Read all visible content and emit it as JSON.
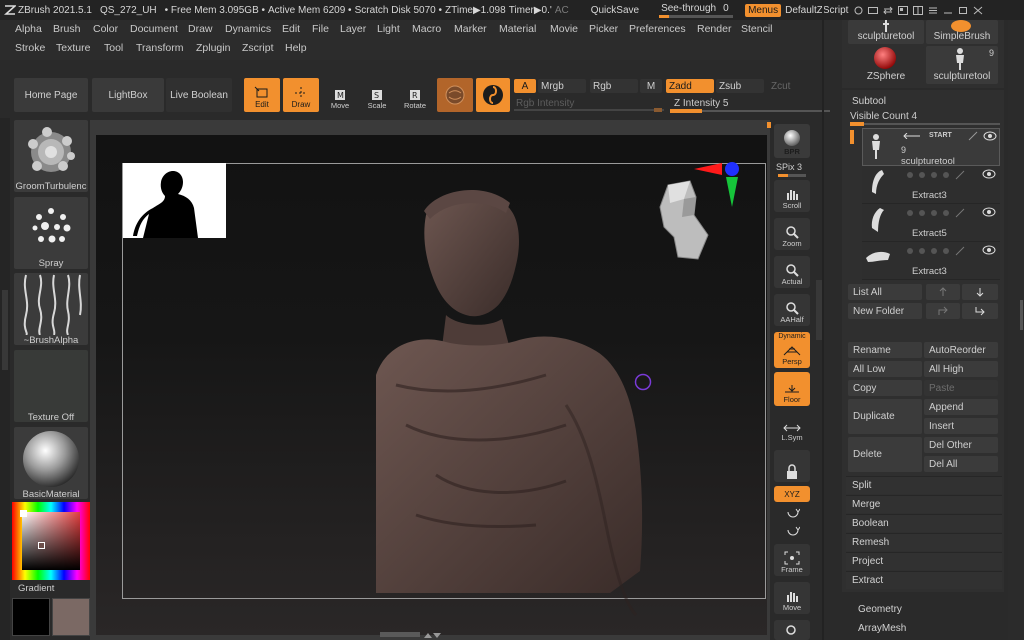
{
  "titlebar": {
    "app": "ZBrush 2021.5.1",
    "doc": "QS_272_UH",
    "free_mem": "• Free Mem 3.095GB •",
    "active_mem": "Active Mem 6209 •",
    "scratch": "Scratch Disk 5070 •",
    "ztime": "ZTime▶1.098",
    "timer": "Timer▶0.'",
    "ac": "AC",
    "quicksave": "QuickSave",
    "see_through": "See-through",
    "see_through_value": "0",
    "menus": "Menus",
    "default_zscript": "DefaultZScript"
  },
  "menus": {
    "row1": [
      "Alpha",
      "Brush",
      "Color",
      "Document",
      "Draw",
      "Dynamics",
      "Edit",
      "File",
      "Layer",
      "Light",
      "Macro",
      "Marker",
      "Material",
      "Movie",
      "Picker",
      "Preferences",
      "Render",
      "Stencil"
    ],
    "row2": [
      "Stroke",
      "Texture",
      "Tool",
      "Transform",
      "Zplugin",
      "Zscript",
      "Help"
    ]
  },
  "toolbar": {
    "home": "Home Page",
    "lightbox": "LightBox",
    "live_boolean": "Live Boolean",
    "edit": "Edit",
    "draw": "Draw",
    "move": "Move",
    "scale": "Scale",
    "rotate": "Rotate",
    "a": "A",
    "mrgb": "Mrgb",
    "rgb": "Rgb",
    "m": "M",
    "zadd": "Zadd",
    "zsub": "Zsub",
    "zcut": "Zcut",
    "rgb_intensity": "Rgb Intensity",
    "z_intensity": "Z Intensity 5",
    "z_intensity_value": 5,
    "z_intensity_max": 100
  },
  "left": {
    "brush": "GroomTurbulenc",
    "stroke": "Spray",
    "alpha": "~BrushAlpha",
    "texture": "Texture Off",
    "material": "BasicMaterial",
    "gradient": "Gradient"
  },
  "right_tools": {
    "bpr": "BPR",
    "spix": "SPix 3",
    "scroll": "Scroll",
    "zoom": "Zoom",
    "actual": "Actual",
    "aahalf": "AAHalf",
    "dynamic": "Dynamic",
    "persp": "Persp",
    "floor": "Floor",
    "lsym": "L.Sym",
    "xyz": "XYZ",
    "frame": "Frame",
    "move": "Move"
  },
  "tool_palette": {
    "top_left": "sculpturetool",
    "top_right": "SimpleBrush",
    "zsphere": "ZSphere",
    "sculpturetool_count": "9",
    "sculpturetool": "sculpturetool"
  },
  "subtool": {
    "title": "Subtool",
    "visible_count": "Visible Count 4",
    "start": "START",
    "items": [
      {
        "count": "9",
        "name": "sculpturetool"
      },
      {
        "name": "Extract3"
      },
      {
        "name": "Extract5"
      },
      {
        "name": "Extract3"
      }
    ],
    "list_all": "List All",
    "new_folder": "New Folder",
    "rename": "Rename",
    "autoreorder": "AutoReorder",
    "all_low": "All Low",
    "all_high": "All High",
    "copy": "Copy",
    "paste": "Paste",
    "duplicate": "Duplicate",
    "append": "Append",
    "insert": "Insert",
    "delete": "Delete",
    "del_other": "Del Other",
    "del_all": "Del All",
    "split": "Split",
    "merge": "Merge",
    "boolean": "Boolean",
    "remesh": "Remesh",
    "project": "Project",
    "extract": "Extract",
    "geometry": "Geometry",
    "arraymesh": "ArrayMesh"
  },
  "colors": {
    "accent": "#f2902e",
    "panel": "#2f2f2f",
    "button": "#3b3b3b"
  }
}
